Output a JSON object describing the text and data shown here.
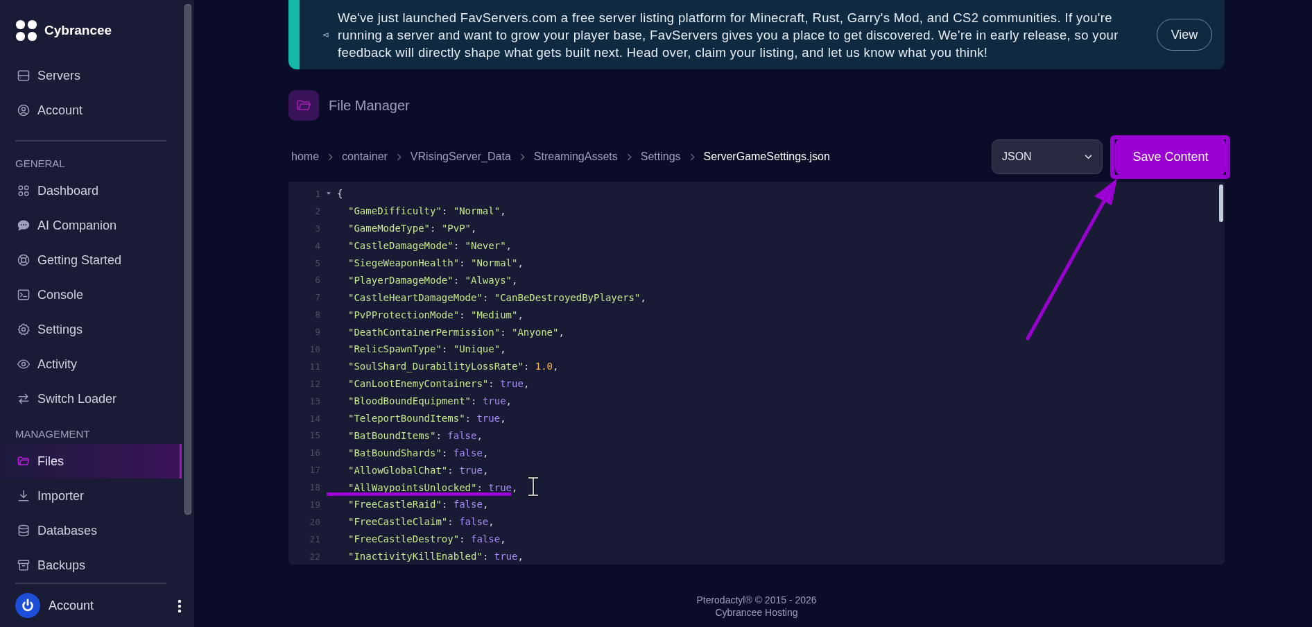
{
  "sidebar": {
    "brand": "Cybrancee",
    "top_items": [
      {
        "label": "Servers",
        "selected": false
      },
      {
        "label": "Account",
        "selected": false
      }
    ],
    "sections": [
      {
        "title": "GENERAL",
        "items": [
          {
            "label": "Dashboard",
            "selected": false
          },
          {
            "label": "AI Companion",
            "selected": false
          },
          {
            "label": "Getting Started",
            "selected": false
          },
          {
            "label": "Console",
            "selected": false
          },
          {
            "label": "Settings",
            "selected": false
          },
          {
            "label": "Activity",
            "selected": false
          },
          {
            "label": "Switch Loader",
            "selected": false
          }
        ]
      },
      {
        "title": "MANAGEMENT",
        "items": [
          {
            "label": "Files",
            "selected": true
          },
          {
            "label": "Importer",
            "selected": false
          },
          {
            "label": "Databases",
            "selected": false
          },
          {
            "label": "Backups",
            "selected": false
          }
        ]
      }
    ],
    "account": {
      "label": "Account"
    }
  },
  "banner": {
    "text": "We've just launched FavServers.com a free server listing platform for Minecraft, Rust, Garry's Mod, and CS2 communities. If you're running a server and want to grow your player base, FavServers gives you a place to get discovered. We're in early release, so your feedback will directly shape what gets built next. Head over, claim your listing, and let us know what you think!",
    "button": "View"
  },
  "page_title": "File Manager",
  "breadcrumb": [
    "home",
    "container",
    "VRisingServer_Data",
    "StreamingAssets",
    "Settings",
    "ServerGameSettings.json"
  ],
  "language_select": {
    "value": "JSON"
  },
  "save_button": "Save Content",
  "editor": {
    "lines": [
      {
        "number": "1",
        "fold": true,
        "tokens": [
          {
            "text": "{",
            "kind": "punct"
          }
        ]
      },
      {
        "number": "2",
        "tokens": [
          {
            "text": "\"GameDifficulty\"",
            "kind": "key"
          },
          {
            "text": ": ",
            "kind": "punct"
          },
          {
            "text": "\"Normal\"",
            "kind": "string"
          },
          {
            "text": ",",
            "kind": "punct"
          }
        ]
      },
      {
        "number": "3",
        "tokens": [
          {
            "text": "\"GameModeType\"",
            "kind": "key"
          },
          {
            "text": ": ",
            "kind": "punct"
          },
          {
            "text": "\"PvP\"",
            "kind": "string"
          },
          {
            "text": ",",
            "kind": "punct"
          }
        ]
      },
      {
        "number": "4",
        "tokens": [
          {
            "text": "\"CastleDamageMode\"",
            "kind": "key"
          },
          {
            "text": ": ",
            "kind": "punct"
          },
          {
            "text": "\"Never\"",
            "kind": "string"
          },
          {
            "text": ",",
            "kind": "punct"
          }
        ]
      },
      {
        "number": "5",
        "tokens": [
          {
            "text": "\"SiegeWeaponHealth\"",
            "kind": "key"
          },
          {
            "text": ": ",
            "kind": "punct"
          },
          {
            "text": "\"Normal\"",
            "kind": "string"
          },
          {
            "text": ",",
            "kind": "punct"
          }
        ]
      },
      {
        "number": "6",
        "tokens": [
          {
            "text": "\"PlayerDamageMode\"",
            "kind": "key"
          },
          {
            "text": ": ",
            "kind": "punct"
          },
          {
            "text": "\"Always\"",
            "kind": "string"
          },
          {
            "text": ",",
            "kind": "punct"
          }
        ]
      },
      {
        "number": "7",
        "tokens": [
          {
            "text": "\"CastleHeartDamageMode\"",
            "kind": "key"
          },
          {
            "text": ": ",
            "kind": "punct"
          },
          {
            "text": "\"CanBeDestroyedByPlayers\"",
            "kind": "string"
          },
          {
            "text": ",",
            "kind": "punct"
          }
        ]
      },
      {
        "number": "8",
        "tokens": [
          {
            "text": "\"PvPProtectionMode\"",
            "kind": "key"
          },
          {
            "text": ": ",
            "kind": "punct"
          },
          {
            "text": "\"Medium\"",
            "kind": "string"
          },
          {
            "text": ",",
            "kind": "punct"
          }
        ]
      },
      {
        "number": "9",
        "tokens": [
          {
            "text": "\"DeathContainerPermission\"",
            "kind": "key"
          },
          {
            "text": ": ",
            "kind": "punct"
          },
          {
            "text": "\"Anyone\"",
            "kind": "string"
          },
          {
            "text": ",",
            "kind": "punct"
          }
        ]
      },
      {
        "number": "10",
        "tokens": [
          {
            "text": "\"RelicSpawnType\"",
            "kind": "key"
          },
          {
            "text": ": ",
            "kind": "punct"
          },
          {
            "text": "\"Unique\"",
            "kind": "string"
          },
          {
            "text": ",",
            "kind": "punct"
          }
        ]
      },
      {
        "number": "11",
        "tokens": [
          {
            "text": "\"SoulShard_DurabilityLossRate\"",
            "kind": "key"
          },
          {
            "text": ": ",
            "kind": "punct"
          },
          {
            "text": "1.0",
            "kind": "number"
          },
          {
            "text": ",",
            "kind": "punct"
          }
        ]
      },
      {
        "number": "12",
        "tokens": [
          {
            "text": "\"CanLootEnemyContainers\"",
            "kind": "key"
          },
          {
            "text": ": ",
            "kind": "punct"
          },
          {
            "text": "true",
            "kind": "bool"
          },
          {
            "text": ",",
            "kind": "punct"
          }
        ]
      },
      {
        "number": "13",
        "tokens": [
          {
            "text": "\"BloodBoundEquipment\"",
            "kind": "key"
          },
          {
            "text": ": ",
            "kind": "punct"
          },
          {
            "text": "true",
            "kind": "bool"
          },
          {
            "text": ",",
            "kind": "punct"
          }
        ]
      },
      {
        "number": "14",
        "tokens": [
          {
            "text": "\"TeleportBoundItems\"",
            "kind": "key"
          },
          {
            "text": ": ",
            "kind": "punct"
          },
          {
            "text": "true",
            "kind": "bool"
          },
          {
            "text": ",",
            "kind": "punct"
          }
        ]
      },
      {
        "number": "15",
        "tokens": [
          {
            "text": "\"BatBoundItems\"",
            "kind": "key"
          },
          {
            "text": ": ",
            "kind": "punct"
          },
          {
            "text": "false",
            "kind": "bool"
          },
          {
            "text": ",",
            "kind": "punct"
          }
        ]
      },
      {
        "number": "16",
        "tokens": [
          {
            "text": "\"BatBoundShards\"",
            "kind": "key"
          },
          {
            "text": ": ",
            "kind": "punct"
          },
          {
            "text": "false",
            "kind": "bool"
          },
          {
            "text": ",",
            "kind": "punct"
          }
        ]
      },
      {
        "number": "17",
        "tokens": [
          {
            "text": "\"AllowGlobalChat\"",
            "kind": "key"
          },
          {
            "text": ": ",
            "kind": "punct"
          },
          {
            "text": "true",
            "kind": "bool"
          },
          {
            "text": ",",
            "kind": "punct"
          }
        ]
      },
      {
        "number": "18",
        "tokens": [
          {
            "text": "\"AllWaypointsUnlocked\"",
            "kind": "key"
          },
          {
            "text": ": ",
            "kind": "punct"
          },
          {
            "text": "true",
            "kind": "bool"
          },
          {
            "text": ",",
            "kind": "punct"
          }
        ]
      },
      {
        "number": "19",
        "tokens": [
          {
            "text": "\"FreeCastleRaid\"",
            "kind": "key"
          },
          {
            "text": ": ",
            "kind": "punct"
          },
          {
            "text": "false",
            "kind": "bool"
          },
          {
            "text": ",",
            "kind": "punct"
          }
        ]
      },
      {
        "number": "20",
        "tokens": [
          {
            "text": "\"FreeCastleClaim\"",
            "kind": "key"
          },
          {
            "text": ": ",
            "kind": "punct"
          },
          {
            "text": "false",
            "kind": "bool"
          },
          {
            "text": ",",
            "kind": "punct"
          }
        ]
      },
      {
        "number": "21",
        "tokens": [
          {
            "text": "\"FreeCastleDestroy\"",
            "kind": "key"
          },
          {
            "text": ": ",
            "kind": "punct"
          },
          {
            "text": "false",
            "kind": "bool"
          },
          {
            "text": ",",
            "kind": "punct"
          }
        ]
      },
      {
        "number": "22",
        "tokens": [
          {
            "text": "\"InactivityKillEnabled\"",
            "kind": "key"
          },
          {
            "text": ": ",
            "kind": "punct"
          },
          {
            "text": "true",
            "kind": "bool"
          },
          {
            "text": ",",
            "kind": "punct"
          }
        ]
      }
    ]
  },
  "footer": {
    "line_1": "Pterodactyl® © 2015 - 2026",
    "line_2": "Cybrancee Hosting"
  }
}
